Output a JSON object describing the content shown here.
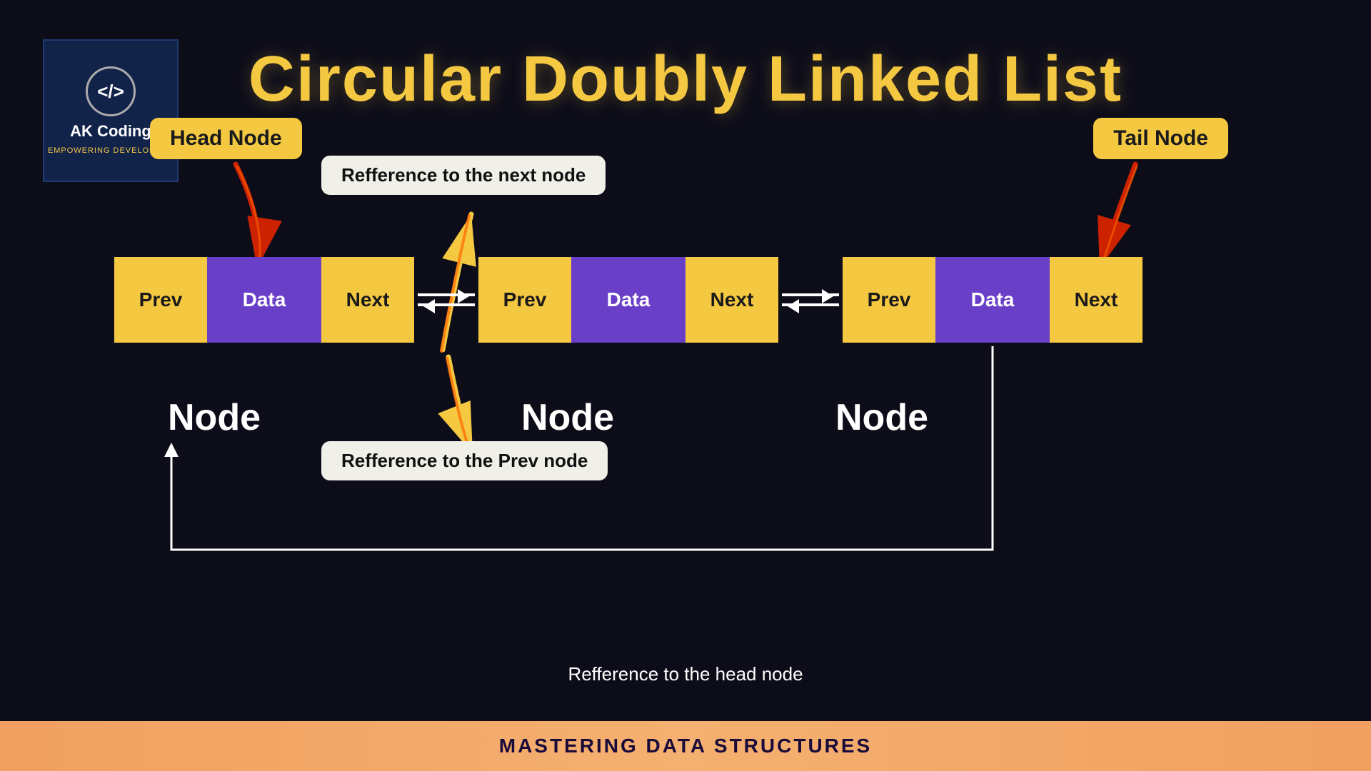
{
  "title": "Circular Doubly Linked List",
  "logo": {
    "icon": "</>",
    "title": "AK Coding",
    "subtitle": "Empowering Developers"
  },
  "labels": {
    "head_node": "Head Node",
    "tail_node": "Tail Node",
    "ref_next": "Refference to the next node",
    "ref_prev": "Refference to the Prev node",
    "ref_head": "Refference to the head node",
    "node1": "Node",
    "node2": "Node",
    "node3": "Node"
  },
  "cells": {
    "prev": "Prev",
    "data": "Data",
    "next": "Next"
  },
  "footer": "MASTERING DATA STRUCTURES"
}
